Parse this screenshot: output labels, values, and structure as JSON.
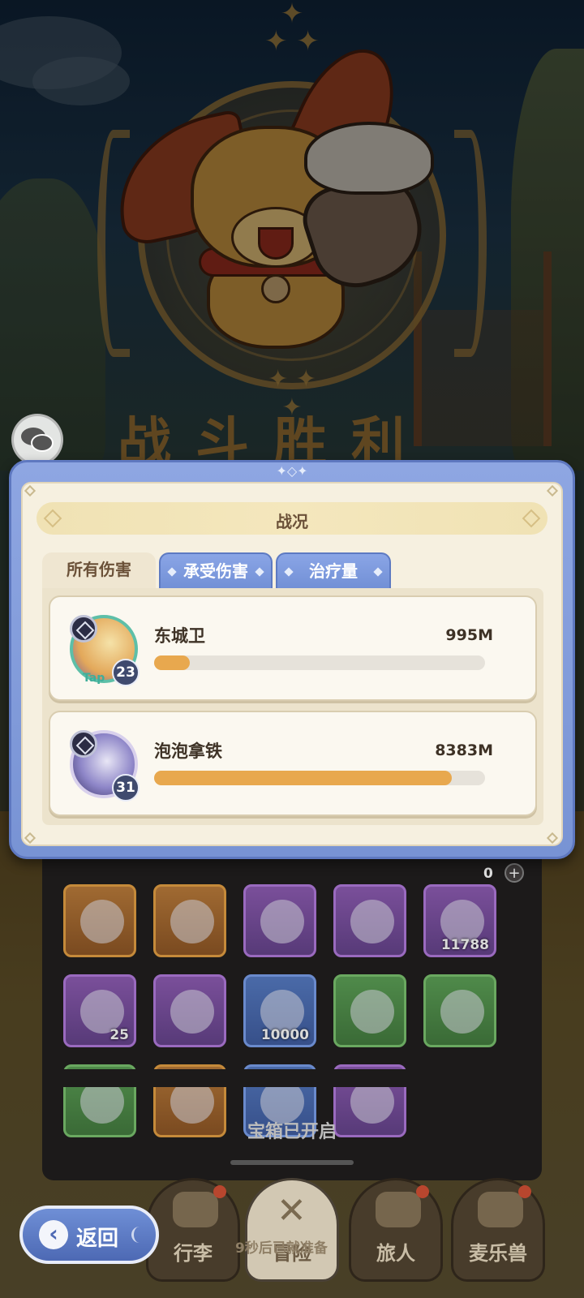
{
  "battle_result": {
    "title": "战斗胜利"
  },
  "stats_dialog": {
    "title": "战况",
    "tabs": [
      {
        "label": "所有伤害",
        "active": true
      },
      {
        "label": "承受伤害",
        "active": false
      },
      {
        "label": "治疗量",
        "active": false
      }
    ],
    "rows": [
      {
        "name": "东城卫",
        "value": "995M",
        "level": "23",
        "avatar_caption": "Tap",
        "bar_fraction": 0.107
      },
      {
        "name": "泡泡拿铁",
        "value": "8383M",
        "level": "31",
        "avatar_caption": "",
        "bar_fraction": 0.9
      }
    ]
  },
  "rewards": {
    "currency_count": "0",
    "add_label": "+",
    "items": [
      {
        "icon": "spear-icon",
        "rarity": "orange",
        "qty": ""
      },
      {
        "icon": "armor-icon",
        "rarity": "orange",
        "qty": ""
      },
      {
        "icon": "necklace-icon",
        "rarity": "purple",
        "qty": ""
      },
      {
        "icon": "ring-icon",
        "rarity": "purple",
        "qty": ""
      },
      {
        "icon": "ingot-icon",
        "rarity": "purple",
        "qty": "11788"
      },
      {
        "icon": "ticket-icon",
        "rarity": "purple",
        "qty": "25"
      },
      {
        "icon": "ring-icon",
        "rarity": "purple",
        "qty": ""
      },
      {
        "icon": "gold-coin-icon",
        "rarity": "blue",
        "qty": "10000"
      },
      {
        "icon": "helmet-icon",
        "rarity": "green",
        "qty": ""
      },
      {
        "icon": "bracer-icon",
        "rarity": "green",
        "qty": ""
      },
      {
        "icon": "ring-icon",
        "rarity": "green",
        "qty": ""
      },
      {
        "icon": "necklace-icon",
        "rarity": "orange",
        "qty": ""
      },
      {
        "icon": "hat-icon",
        "rarity": "blue",
        "qty": ""
      },
      {
        "icon": "orb-icon",
        "rarity": "purple",
        "qty": ""
      }
    ],
    "status_text": "宝箱已开启"
  },
  "bottom_nav": {
    "back_label": "返回",
    "items": [
      {
        "label": "行李",
        "icon": "luggage-icon",
        "has_dot": true
      },
      {
        "label": "冒险",
        "icon": "crossed-swords-icon",
        "has_dot": false
      },
      {
        "label": "旅人",
        "icon": "traveler-icon",
        "has_dot": true
      },
      {
        "label": "麦乐兽",
        "icon": "pet-icon",
        "has_dot": true
      }
    ],
    "countdown_text": "9秒后已就准备"
  },
  "colors": {
    "dialog_frame": "#7893d4",
    "dialog_body": "#f6f0e0",
    "bar_fill": "#e8a84e",
    "bar_track": "#e6e2da",
    "title_bar": "#f0e2b4"
  }
}
